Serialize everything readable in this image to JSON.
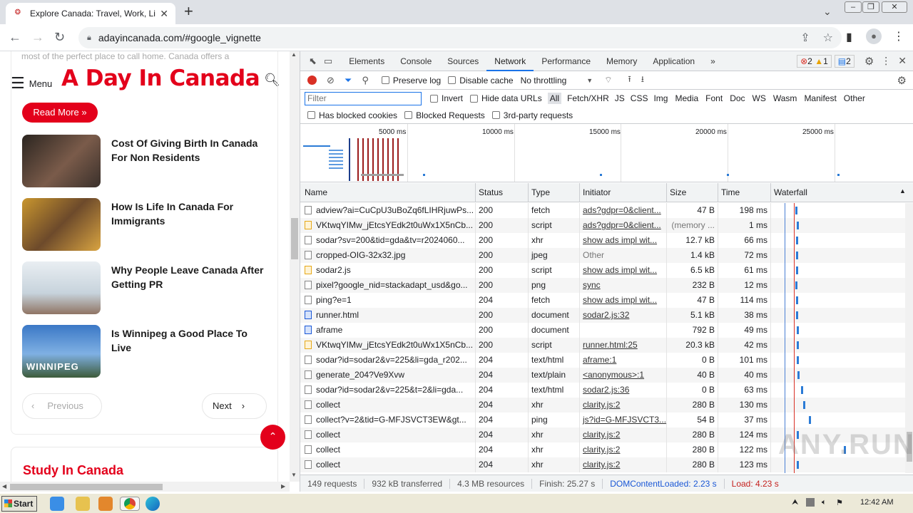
{
  "browser": {
    "tab_title": "Explore Canada: Travel, Work, Live,",
    "url": "adayincanada.com/#google_vignette",
    "new_tab": "+",
    "tab_close": "✕"
  },
  "site": {
    "faded_text": "most of the perfect place to call home. Canada offers a",
    "menu_label": "Menu",
    "logo": "A Day In Canada",
    "read_more": "Read More »",
    "posts": [
      {
        "title": "Cost Of Giving Birth In Canada For Non Residents"
      },
      {
        "title": "How Is Life In Canada For Immigrants"
      },
      {
        "title": "Why People Leave Canada After Getting PR"
      },
      {
        "title": "Is Winnipeg a Good Place To Live"
      }
    ],
    "thumb_caption": "WINNIPEG",
    "prev_label": "Previous",
    "next_label": "Next",
    "study_heading": "Study In Canada"
  },
  "devtools": {
    "tabs": [
      "Elements",
      "Console",
      "Sources",
      "Network",
      "Performance",
      "Memory",
      "Application"
    ],
    "active_tab": "Network",
    "more_tabs": "»",
    "errors": "2",
    "warnings": "1",
    "messages": "2",
    "preserve_log": "Preserve log",
    "disable_cache": "Disable cache",
    "throttling": "No throttling",
    "filter_placeholder": "Filter",
    "invert": "Invert",
    "hide_data_urls": "Hide data URLs",
    "type_filters": [
      "All",
      "Fetch/XHR",
      "JS",
      "CSS",
      "Img",
      "Media",
      "Font",
      "Doc",
      "WS",
      "Wasm",
      "Manifest",
      "Other"
    ],
    "has_blocked_cookies": "Has blocked cookies",
    "blocked_requests": "Blocked Requests",
    "third_party": "3rd-party requests",
    "timeline_ticks": [
      "5000 ms",
      "10000 ms",
      "15000 ms",
      "20000 ms",
      "25000 ms"
    ],
    "columns": [
      "Name",
      "Status",
      "Type",
      "Initiator",
      "Size",
      "Time",
      "Waterfall"
    ],
    "requests": [
      {
        "name": "adview?ai=CuCpU3uBoZq6fLIHRjuwPs...",
        "status": "200",
        "type": "fetch",
        "initiator": "ads?gdpr=0&client...",
        "size": "47 B",
        "time": "198 ms"
      },
      {
        "name": "VKtwqYIMw_jEtcsYEdk2t0uWx1X5nCb...",
        "status": "200",
        "type": "script",
        "initiator": "ads?gdpr=0&client...",
        "size": "(memory ...",
        "time": "1 ms"
      },
      {
        "name": "sodar?sv=200&tid=gda&tv=r2024060...",
        "status": "200",
        "type": "xhr",
        "initiator": "show ads impl wit...",
        "size": "12.7 kB",
        "time": "66 ms"
      },
      {
        "name": "cropped-OIG-32x32.jpg",
        "status": "200",
        "type": "jpeg",
        "initiator": "Other",
        "size": "1.4 kB",
        "time": "72 ms"
      },
      {
        "name": "sodar2.js",
        "status": "200",
        "type": "script",
        "initiator": "show ads impl wit...",
        "size": "6.5 kB",
        "time": "61 ms"
      },
      {
        "name": "pixel?google_nid=stackadapt_usd&go...",
        "status": "200",
        "type": "png",
        "initiator": "sync",
        "size": "232 B",
        "time": "12 ms"
      },
      {
        "name": "ping?e=1",
        "status": "204",
        "type": "fetch",
        "initiator": "show ads impl wit...",
        "size": "47 B",
        "time": "114 ms"
      },
      {
        "name": "runner.html",
        "status": "200",
        "type": "document",
        "initiator": "sodar2.js:32",
        "size": "5.1 kB",
        "time": "38 ms"
      },
      {
        "name": "aframe",
        "status": "200",
        "type": "document",
        "initiator": "",
        "size": "792 B",
        "time": "49 ms"
      },
      {
        "name": "VKtwqYIMw_jEtcsYEdk2t0uWx1X5nCb...",
        "status": "200",
        "type": "script",
        "initiator": "runner.html:25",
        "size": "20.3 kB",
        "time": "42 ms"
      },
      {
        "name": "sodar?id=sodar2&v=225&li=gda_r202...",
        "status": "204",
        "type": "text/html",
        "initiator": "aframe:1",
        "size": "0 B",
        "time": "101 ms"
      },
      {
        "name": "generate_204?Ve9Xvw",
        "status": "204",
        "type": "text/plain",
        "initiator": "<anonymous>:1",
        "size": "40 B",
        "time": "40 ms"
      },
      {
        "name": "sodar?id=sodar2&v=225&t=2&li=gda...",
        "status": "204",
        "type": "text/html",
        "initiator": "sodar2.js:36",
        "size": "0 B",
        "time": "63 ms"
      },
      {
        "name": "collect",
        "status": "204",
        "type": "xhr",
        "initiator": "clarity.js:2",
        "size": "280 B",
        "time": "130 ms"
      },
      {
        "name": "collect?v=2&tid=G-MFJSVCT3EW&gt...",
        "status": "204",
        "type": "ping",
        "initiator": "js?id=G-MFJSVCT3...",
        "size": "54 B",
        "time": "37 ms"
      },
      {
        "name": "collect",
        "status": "204",
        "type": "xhr",
        "initiator": "clarity.js:2",
        "size": "280 B",
        "time": "124 ms"
      },
      {
        "name": "collect",
        "status": "204",
        "type": "xhr",
        "initiator": "clarity.js:2",
        "size": "280 B",
        "time": "122 ms"
      },
      {
        "name": "collect",
        "status": "204",
        "type": "xhr",
        "initiator": "clarity.js:2",
        "size": "280 B",
        "time": "123 ms"
      }
    ],
    "summary": {
      "requests": "149 requests",
      "transferred": "932 kB transferred",
      "resources": "4.3 MB resources",
      "finish": "Finish: 25.27 s",
      "dcl": "DOMContentLoaded: 2.23 s",
      "load": "Load: 4.23 s"
    }
  },
  "taskbar": {
    "start": "Start",
    "clock": "12:42 AM"
  },
  "watermark": "ANY.RUN"
}
